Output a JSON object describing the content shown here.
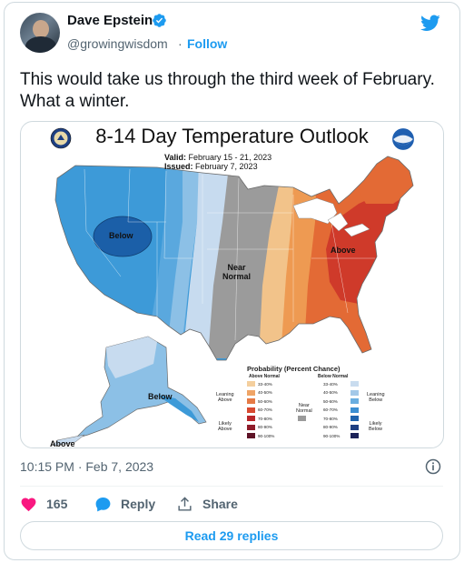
{
  "author": {
    "name": "Dave Epstein",
    "handle": "@growingwisdom",
    "separator": "·",
    "follow_label": "Follow"
  },
  "tweet": {
    "text": "This would take us through the third week of February. What a winter."
  },
  "map": {
    "title": "8-14 Day Temperature Outlook",
    "valid_label": "Valid:",
    "valid_value": "February 15 - 21, 2023",
    "issued_label": "Issued:",
    "issued_value": "February 7, 2023",
    "region_labels": {
      "below_west": "Below",
      "near_normal_line1": "Near",
      "near_normal_line2": "Normal",
      "above_east": "Above",
      "below_alaska": "Below",
      "above_alaska": "Above"
    },
    "colors": {
      "below_dark": "#1b5fa8",
      "below_mid": "#3d9ad8",
      "below_light": "#8cc0e6",
      "below_lightest": "#c7dbef",
      "near_normal": "#9b9b9b",
      "above_lightest": "#f2c38a",
      "above_light": "#ee9a52",
      "above_mid": "#e36a35",
      "above_dark": "#cf3a2a"
    },
    "legend": {
      "title": "Probability (Percent Chance)",
      "above_header": "Above Normal",
      "below_header": "Below Normal",
      "near_label_line1": "Near",
      "near_label_line2": "Normal",
      "leaning_above_line1": "Leaning",
      "leaning_above_line2": "Above",
      "likely_above_line1": "Likely",
      "likely_above_line2": "Above",
      "leaning_below_line1": "Leaning",
      "leaning_below_line2": "Below",
      "likely_below_line1": "Likely",
      "likely_below_line2": "Below",
      "ranges": [
        "33-40%",
        "40-50%",
        "50-60%",
        "60-70%",
        "70-80%",
        "80-90%",
        "90-100%"
      ],
      "above_colors": [
        "#f4cf9e",
        "#efa466",
        "#e57a45",
        "#d84a30",
        "#b9262a",
        "#8f1c2a",
        "#5e1226"
      ],
      "below_colors": [
        "#c9dcef",
        "#a3c8e8",
        "#6aaee0",
        "#3c8fd2",
        "#1f63ad",
        "#1d3f82",
        "#1b2258"
      ],
      "near_color": "#9b9b9b"
    }
  },
  "meta": {
    "timestamp": "10:15 PM · Feb 7, 2023"
  },
  "engagement": {
    "likes": "165",
    "reply_label": "Reply",
    "share_label": "Share",
    "read_replies_label": "Read 29 replies"
  }
}
